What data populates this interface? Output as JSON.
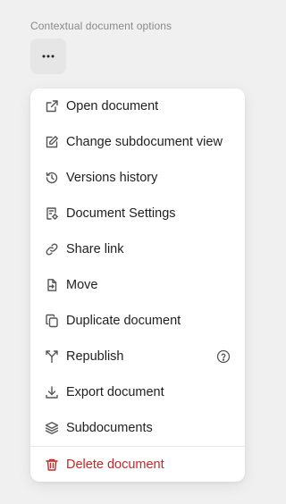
{
  "section_label": "Contextual document options",
  "menu": {
    "items": [
      {
        "label": "Open document",
        "icon": "external-link-icon"
      },
      {
        "label": "Change subdocument view",
        "icon": "edit-icon"
      },
      {
        "label": "Versions history",
        "icon": "history-icon"
      },
      {
        "label": "Document Settings",
        "icon": "document-settings-icon"
      },
      {
        "label": "Share link",
        "icon": "link-icon"
      },
      {
        "label": "Move",
        "icon": "move-icon"
      },
      {
        "label": "Duplicate document",
        "icon": "copy-icon"
      },
      {
        "label": "Republish",
        "icon": "republish-icon"
      },
      {
        "label": "Export document",
        "icon": "download-icon"
      },
      {
        "label": "Subdocuments",
        "icon": "layers-icon"
      }
    ],
    "delete": {
      "label": "Delete document",
      "icon": "trash-icon"
    }
  },
  "colors": {
    "danger": "#c62828",
    "background": "#f0f0f0"
  }
}
